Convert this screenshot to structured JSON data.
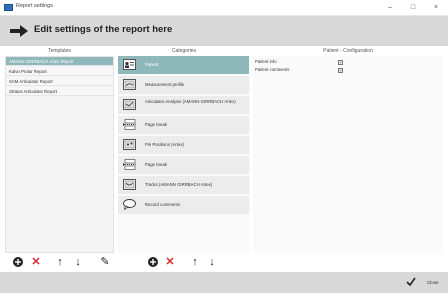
{
  "window": {
    "title": "Report settings",
    "minimize": "–",
    "maximize": "□",
    "close": "×"
  },
  "header": {
    "heading": "Edit settings of the report here"
  },
  "columns": {
    "templates": "Templates",
    "categories": "Categories",
    "config": "Patient - Configuration"
  },
  "templates": [
    "AMANN GIRRBACH Artex Report",
    "Kalvo Protar Report",
    "SAM Articulator Report",
    "Stratos Articulator Report"
  ],
  "categories": [
    {
      "label": "Patient",
      "icon": "patient-card-icon",
      "selected": true
    },
    {
      "label": "Measurement profile",
      "icon": "profile-icon",
      "selected": false
    },
    {
      "label": "Articulator Analysis (AMANN GIRRBACH Artex)",
      "icon": "analysis-icon",
      "selected": false
    },
    {
      "label": "Page break",
      "icon": "page-break-icon",
      "selected": false
    },
    {
      "label": "Pin Positions (Artex)",
      "icon": "pin-positions-icon",
      "selected": false
    },
    {
      "label": "Page break",
      "icon": "page-break-icon",
      "selected": false
    },
    {
      "label": "Tracks (AMANN GIRRBACH Artex)",
      "icon": "tracks-icon",
      "selected": false
    },
    {
      "label": "Record comments",
      "icon": "comment-icon",
      "selected": false
    }
  ],
  "config": [
    {
      "label": "Patient info",
      "checked": true
    },
    {
      "label": "Patient comments",
      "checked": true
    }
  ],
  "toolbar": {
    "add": "+",
    "remove": "✕",
    "up": "↑",
    "down": "↓",
    "edit": "✎"
  },
  "footer": {
    "close_label": "Close"
  },
  "colors": {
    "header_bg": "#d8d8d8",
    "selected_bg": "#8fb8bb",
    "remove_red": "#d9262b"
  }
}
